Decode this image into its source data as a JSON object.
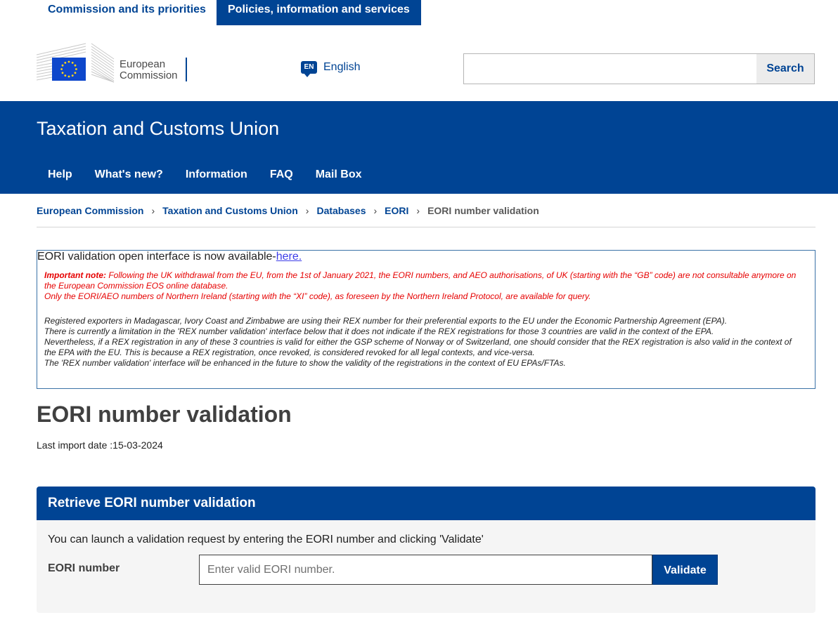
{
  "top_tabs": [
    {
      "label": "Commission and its priorities"
    },
    {
      "label": "Policies, information and services"
    }
  ],
  "logo": {
    "line1": "European",
    "line2": "Commission"
  },
  "language": {
    "code": "EN",
    "label": "English"
  },
  "search": {
    "placeholder": "",
    "button": "Search"
  },
  "site": {
    "title": "Taxation and Customs Union",
    "nav": [
      "Help",
      "What's new?",
      "Information",
      "FAQ",
      "Mail Box"
    ]
  },
  "breadcrumb": {
    "items": [
      "European Commission",
      "Taxation and Customs Union",
      "Databases",
      "EORI"
    ],
    "current": "EORI number validation"
  },
  "notice": {
    "intro": "EORI validation open interface is now available-",
    "link": "here.",
    "important_label": "Important note:",
    "important_text": " Following the UK withdrawal from the EU, from the 1st of January 2021, the EORI numbers, and AEO authorisations, of UK (starting with the “GB” code) are not consultable anymore on the European Commission EOS online database.",
    "ni_text": "Only the EORI/AEO numbers of Northern Ireland (starting with the “XI” code), as foreseen by the Northern Ireland Protocol, are available for query.",
    "rex_lines": [
      "Registered exporters in Madagascar, Ivory Coast and Zimbabwe are using their REX number for their preferential exports to the EU under the Economic Partnership Agreement (EPA).",
      "There is currently a limitation in the 'REX number validation' interface below that it does not indicate if the REX registrations for those 3 countries are valid in the context of the EPA.",
      "Nevertheless, if a REX registration in any of these 3 countries is valid for either the GSP scheme of Norway or of Switzerland, one should consider that the REX registration is also valid in the context of the EPA with the EU. This is because a REX registration, once revoked, is considered revoked for all legal contexts, and vice-versa.",
      "The 'REX number validation' interface will be enhanced in the future to show the validity of the registrations in the context of EU EPAs/FTAs."
    ]
  },
  "page_title": "EORI number validation",
  "last_import": "Last import date :15-03-2024",
  "form": {
    "header": "Retrieve EORI number validation",
    "hint": "You can launch a validation request by entering the EORI number and clicking 'Validate'",
    "field_label": "EORI number",
    "placeholder": "Enter valid EORI number.",
    "value": "",
    "button": "Validate"
  },
  "colors": {
    "brand_blue": "#004494",
    "alert_red": "#e60000",
    "link": "#3d3de8"
  }
}
